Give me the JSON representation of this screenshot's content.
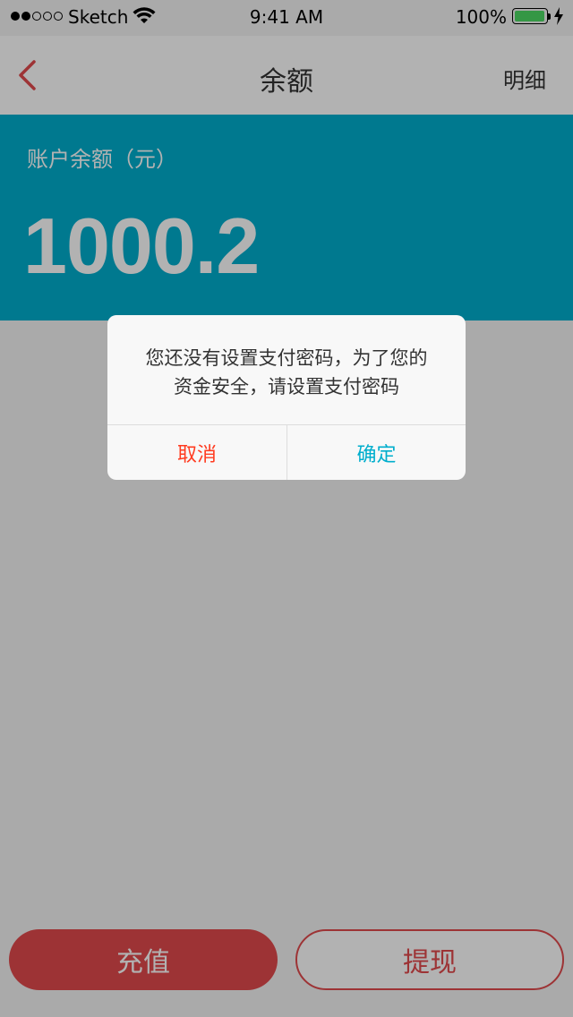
{
  "status_bar": {
    "carrier": "Sketch",
    "time": "9:41 AM",
    "battery_percent": "100%",
    "battery_level": 1.0,
    "signal_strength": 2,
    "signal_total": 5
  },
  "nav": {
    "title": "余额",
    "right_label": "明细",
    "back_icon": "chevron-left-icon"
  },
  "balance": {
    "label": "账户余额（元）",
    "amount": "1000.2"
  },
  "dialog": {
    "message_line1": "您还没有设置支付密码，为了您的",
    "message_line2": "资金安全，请设置支付密码",
    "cancel_label": "取消",
    "confirm_label": "确定"
  },
  "actions": {
    "recharge_label": "充值",
    "withdraw_label": "提现"
  },
  "colors": {
    "accent_red": "#e14a4c",
    "brand_teal": "#00aecd",
    "cancel_red": "#ff3b20",
    "battery_green": "#4cd964"
  }
}
